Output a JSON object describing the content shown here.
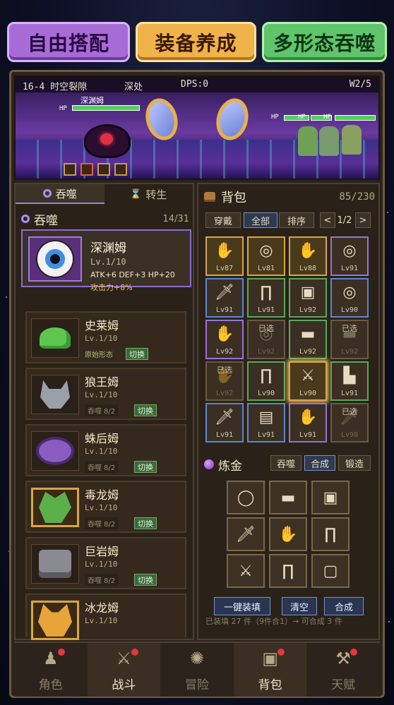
{
  "banners": [
    "自由搭配",
    "装备养成",
    "多形态吞噬"
  ],
  "battle": {
    "stage": "16-4 时空裂隙",
    "depth": "深处",
    "dps": "DPS:0",
    "wave": "W2/5",
    "boss_name": "深渊姆",
    "hp_label": "HP"
  },
  "left": {
    "tabs": [
      "吞噬",
      "转生"
    ],
    "title": "吞噬",
    "count": "14/31",
    "selected": {
      "name": "深渊姆",
      "level": "Lv.1/10",
      "stats": "ATK+6 DEF+3 HP+20",
      "bonus": "攻击力+8%"
    },
    "cards": [
      {
        "name": "史莱姆",
        "level": "Lv.1/10",
        "info": "原始形态",
        "button": "切换"
      },
      {
        "name": "狼王姆",
        "level": "Lv.1/10",
        "info": "吞噬 8/2",
        "button": "切换"
      },
      {
        "name": "蛛后姆",
        "level": "Lv.1/10",
        "info": "吞噬 8/2",
        "button": "切换"
      },
      {
        "name": "毒龙姆",
        "level": "Lv.1/10",
        "info": "吞噬 8/2",
        "button": "切换"
      },
      {
        "name": "巨岩姆",
        "level": "Lv.1/10",
        "info": "吞噬 8/2",
        "button": "切换"
      },
      {
        "name": "冰龙姆",
        "level": "Lv.1/10",
        "info": "",
        "button": ""
      }
    ]
  },
  "bag": {
    "title": "背包",
    "count": "85/230",
    "tools": [
      "穿戴",
      "全部",
      "排序"
    ],
    "page": "1/2",
    "prev": "<",
    "next": ">",
    "items": [
      {
        "icon": "glove-icon",
        "glyph": "✋",
        "level": "Lv87",
        "rarity": "gold"
      },
      {
        "icon": "ring-icon",
        "glyph": "◎",
        "level": "Lv81",
        "rarity": "gold"
      },
      {
        "icon": "glove-icon",
        "glyph": "✋",
        "level": "Lv88",
        "rarity": "gold"
      },
      {
        "icon": "ring-icon",
        "glyph": "◎",
        "level": "Lv91",
        "rarity": "purple"
      },
      {
        "icon": "dagger-icon",
        "glyph": "🗡",
        "level": "Lv91",
        "rarity": "blue"
      },
      {
        "icon": "leggings-icon",
        "glyph": "∏",
        "level": "Lv91",
        "rarity": "green"
      },
      {
        "icon": "armor-icon",
        "glyph": "▣",
        "level": "Lv92",
        "rarity": "green"
      },
      {
        "icon": "ring-icon",
        "glyph": "◎",
        "level": "Lv90",
        "rarity": "blue"
      },
      {
        "icon": "glove-icon",
        "glyph": "✋",
        "level": "Lv92",
        "rarity": "purple"
      },
      {
        "icon": "ring-icon",
        "glyph": "◎",
        "level": "Lv92",
        "rarity": "plain",
        "chosen": "已选"
      },
      {
        "icon": "belt-icon",
        "glyph": "▬",
        "level": "Lv92",
        "rarity": "green"
      },
      {
        "icon": "belt-icon",
        "glyph": "▬",
        "level": "Lv92",
        "rarity": "plain",
        "chosen": "已选"
      },
      {
        "icon": "glove-icon",
        "glyph": "✋",
        "level": "Lv92",
        "rarity": "plain",
        "chosen": "已选"
      },
      {
        "icon": "leggings-icon",
        "glyph": "∏",
        "level": "Lv90",
        "rarity": "green"
      },
      {
        "icon": "sword-icon",
        "glyph": "⚔",
        "level": "Lv90",
        "rarity": "gold"
      },
      {
        "icon": "boots-icon",
        "glyph": "▙",
        "level": "Lv91",
        "rarity": "green"
      },
      {
        "icon": "dagger-icon",
        "glyph": "🗡",
        "level": "Lv91",
        "rarity": "blue"
      },
      {
        "icon": "chainmail-icon",
        "glyph": "▤",
        "level": "Lv91",
        "rarity": "blue"
      },
      {
        "icon": "glove-icon",
        "glyph": "✋",
        "level": "Lv91",
        "rarity": "purple"
      },
      {
        "icon": "dagger-icon",
        "glyph": "🗡",
        "level": "Lv98",
        "rarity": "plain",
        "chosen": "已选"
      }
    ]
  },
  "alchemy": {
    "title": "炼金",
    "tabs": [
      "吞噬",
      "合成",
      "锻造"
    ],
    "slots": [
      {
        "icon": "ring-icon",
        "glyph": "◯"
      },
      {
        "icon": "belt-icon",
        "glyph": "▬"
      },
      {
        "icon": "armor-icon",
        "glyph": "▣"
      },
      {
        "icon": "dagger-icon",
        "glyph": "🗡"
      },
      {
        "icon": "glove-icon",
        "glyph": "✋"
      },
      {
        "icon": "leggings-icon",
        "glyph": "∏"
      },
      {
        "icon": "sword-icon",
        "glyph": "⚔"
      },
      {
        "icon": "leggings-icon",
        "glyph": "∏"
      },
      {
        "icon": "shirt-icon",
        "glyph": "▢"
      }
    ],
    "buttons": [
      "一键装填",
      "清空",
      "合成"
    ],
    "status": "已装填 27 件（9件合1）→ 可合成 3 件"
  },
  "nav": [
    {
      "label": "角色",
      "icon": "character-icon",
      "glyph": "♟",
      "dot": true
    },
    {
      "label": "战斗",
      "icon": "sword-icon",
      "glyph": "⚔",
      "dot": true
    },
    {
      "label": "冒险",
      "icon": "compass-icon",
      "glyph": "✺",
      "dot": false
    },
    {
      "label": "背包",
      "icon": "backpack-icon",
      "glyph": "▣",
      "dot": true
    },
    {
      "label": "天赋",
      "icon": "anvil-icon",
      "glyph": "⚒",
      "dot": true
    }
  ],
  "colors": {
    "banner_purple": "#a76bd6",
    "banner_gold": "#f0b24a",
    "banner_green": "#5fc46c",
    "panel": "#2a2219",
    "accent_blue": "#2e3a52",
    "notify_red": "#e03a3a"
  }
}
